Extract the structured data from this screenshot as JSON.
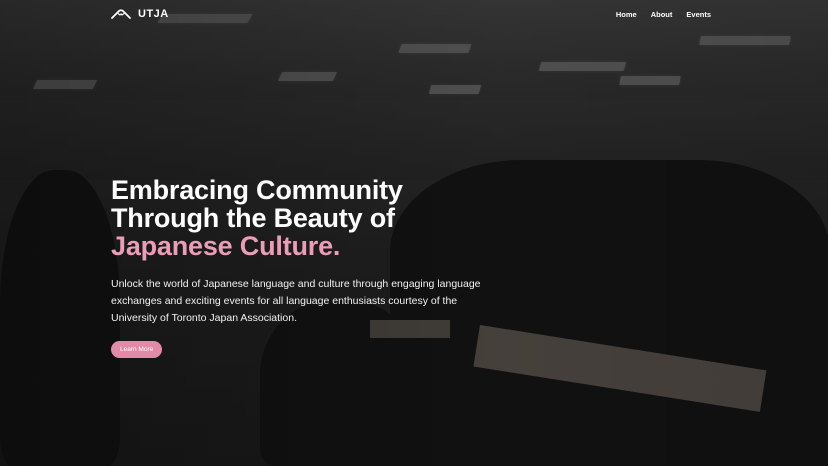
{
  "brand": {
    "name": "UTJA",
    "logo_icon": "mountain-logo-icon"
  },
  "nav": {
    "items": [
      {
        "label": "Home"
      },
      {
        "label": "About"
      },
      {
        "label": "Events"
      }
    ]
  },
  "hero": {
    "title_line1": "Embracing Community",
    "title_line2": "Through the Beauty of",
    "title_accent": "Japanese Culture.",
    "description": "Unlock the world of Japanese language and culture through engaging language exchanges and exciting events for all language enthusiasts courtesy of the University of Toronto Japan Association.",
    "cta_label": "Learn More",
    "background": "classroom-crowd-photo"
  },
  "colors": {
    "accent": "#eb9db8",
    "button": "#e48aa9",
    "text": "#ffffff"
  }
}
